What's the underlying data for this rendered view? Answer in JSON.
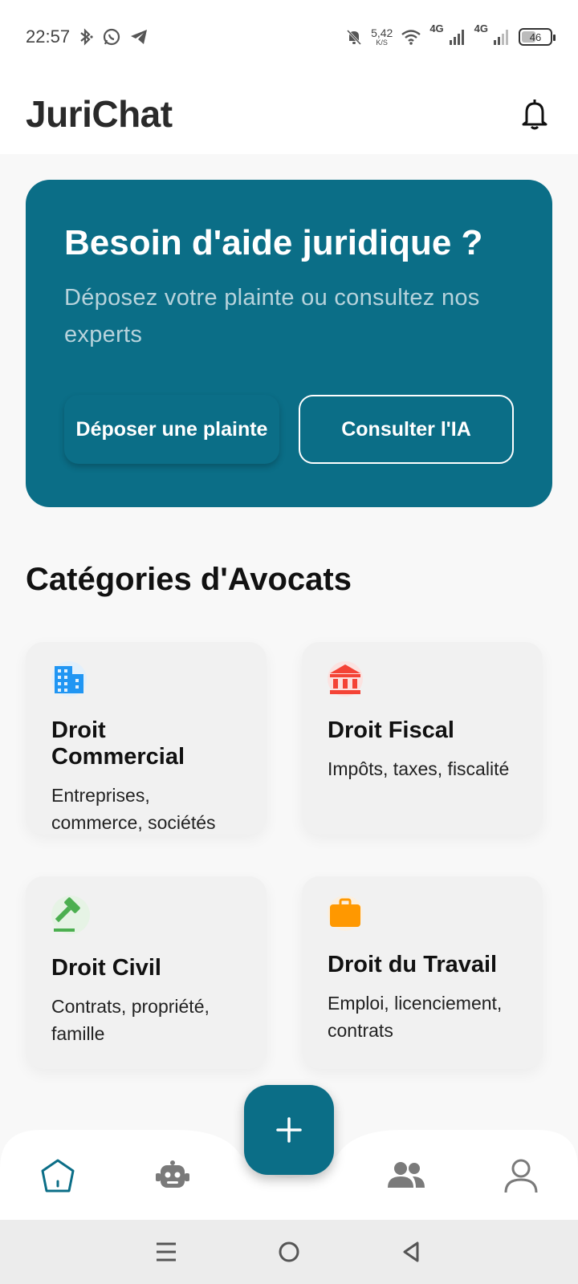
{
  "status": {
    "time": "22:57",
    "net_speed_value": "5,42",
    "net_speed_unit": "K/S",
    "network_1": "4G",
    "network_2": "4G",
    "battery": "46",
    "battery_level": 0.46
  },
  "appbar": {
    "title": "JuriChat"
  },
  "hero": {
    "title": "Besoin d'aide juridique ?",
    "subtitle": "Déposez votre plainte ou consultez nos experts",
    "primary_button": "Déposer une plainte",
    "secondary_button": "Consulter l'IA"
  },
  "categories": {
    "title": "Catégories d'Avocats",
    "items": [
      {
        "name": "Droit Commercial",
        "desc": "Entreprises, commerce, sociétés",
        "icon": "building-icon",
        "color": "#2196f3",
        "bg": "#e3f0fb"
      },
      {
        "name": "Droit Fiscal",
        "desc": "Impôts, taxes, fiscalité",
        "icon": "bank-icon",
        "color": "#f44336",
        "bg": "#fbe3e1"
      },
      {
        "name": "Droit Civil",
        "desc": "Contrats, propriété, famille",
        "icon": "gavel-icon",
        "color": "#4caf50",
        "bg": "#e6f3e5"
      },
      {
        "name": "Droit du Travail",
        "desc": "Emploi, licenciement, contrats",
        "icon": "briefcase-icon",
        "color": "#ff9800",
        "bg": "#fbefdf"
      }
    ]
  },
  "colors": {
    "primary": "#0b6e87",
    "nav_inactive": "#7a7a7a"
  },
  "bottom_nav": {
    "items": [
      "home-icon",
      "robot-icon",
      "group-icon",
      "person-icon"
    ],
    "fab_icon": "plus-icon"
  }
}
